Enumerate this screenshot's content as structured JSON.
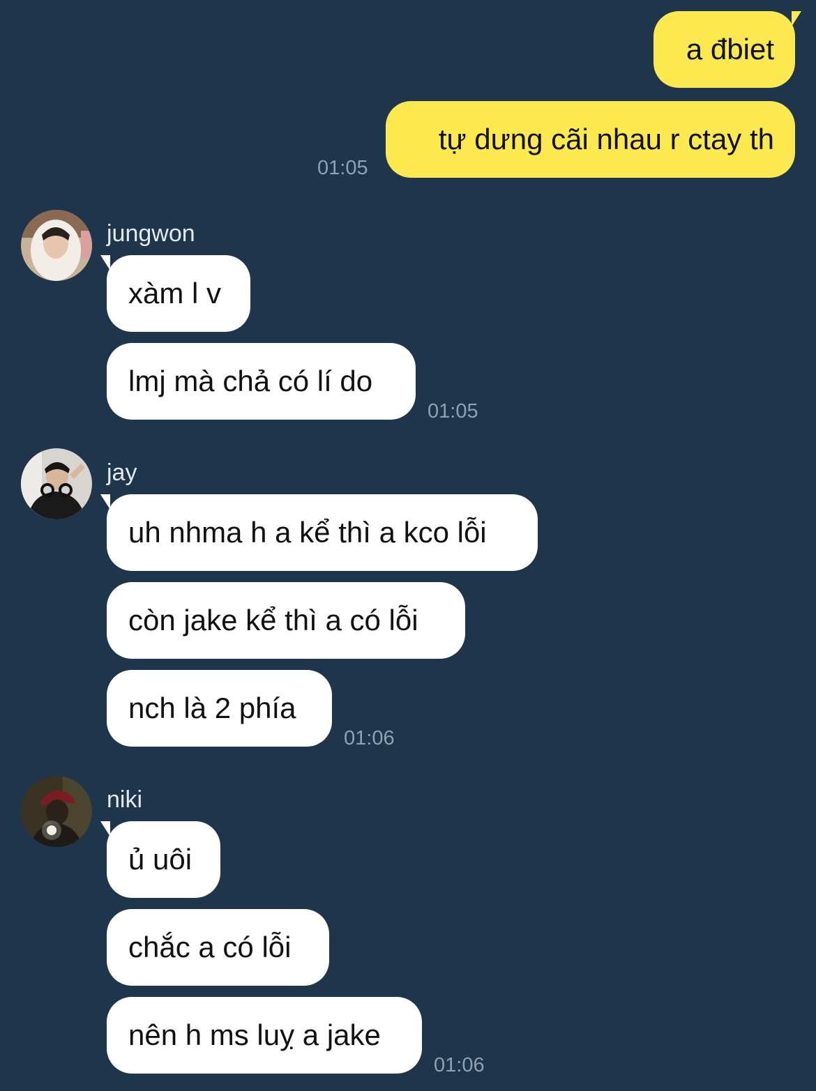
{
  "colors": {
    "background": "#1e354b",
    "outgoing_bubble": "#fbe94f",
    "incoming_bubble": "#ffffff",
    "timestamp": "#8fa1b2",
    "sender_name": "#e3e9ef"
  },
  "outgoing": {
    "messages": [
      "a đbiet",
      "tự dưng cãi nhau r ctay th"
    ],
    "time": "01:05"
  },
  "groups": [
    {
      "sender": "jungwon",
      "avatar": "avatar-jungwon",
      "messages": [
        "xàm l v",
        "lmj mà chả có lí do"
      ],
      "time": "01:05"
    },
    {
      "sender": "jay",
      "avatar": "avatar-jay",
      "messages": [
        "uh nhma h a kể thì a kco lỗi",
        "còn jake kể thì a có lỗi",
        "nch là 2 phía"
      ],
      "time": "01:06"
    },
    {
      "sender": "niki",
      "avatar": "avatar-niki",
      "messages": [
        "ủ uôi",
        "chắc a có lỗi",
        "nên h ms luỵ a jake"
      ],
      "time": "01:06"
    }
  ]
}
